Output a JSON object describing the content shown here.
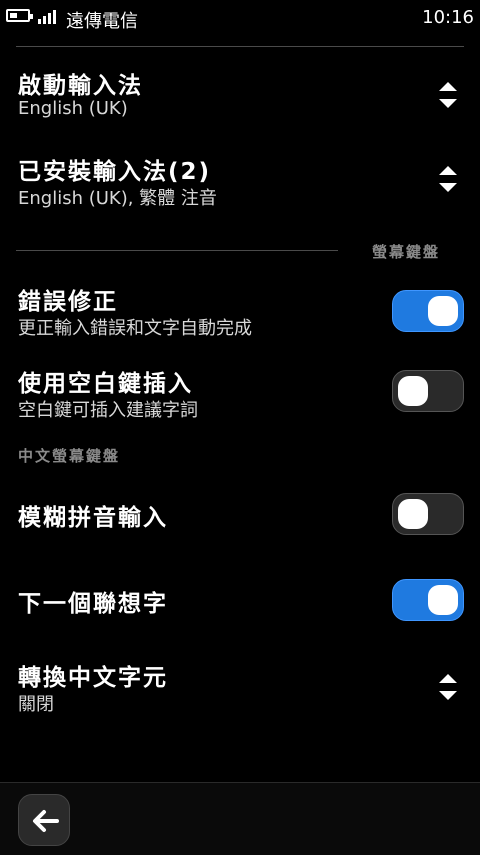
{
  "status": {
    "carrier": "遠傳電信",
    "time": "10:16",
    "battery_level": 0.4,
    "signal_bars": 4
  },
  "settings": {
    "active_input": {
      "title": "啟動輸入法",
      "value": "English (UK)"
    },
    "installed_input": {
      "title": "已安裝輸入法(2)",
      "value": "English (UK), 繁體 注音"
    },
    "onscreen_keyboard_header": "螢幕鍵盤",
    "error_correction": {
      "title": "錯誤修正",
      "desc": "更正輸入錯誤和文字自動完成",
      "enabled": true
    },
    "space_insert": {
      "title": "使用空白鍵插入",
      "desc": "空白鍵可插入建議字詞",
      "enabled": false
    },
    "chinese_keyboard_header": "中文螢幕鍵盤",
    "fuzzy_pinyin": {
      "title": "模糊拼音輸入",
      "enabled": false
    },
    "next_prediction": {
      "title": "下一個聯想字",
      "enabled": true
    },
    "convert_chinese": {
      "title": "轉換中文字元",
      "value": "關閉"
    }
  },
  "colors": {
    "toggle_on": "#1f7ae0",
    "toggle_off": "#2a2a2a",
    "section_text": "#8a8a8a"
  },
  "icons": {
    "back": "back-arrow-icon",
    "selector": "up-down-arrows-icon"
  }
}
